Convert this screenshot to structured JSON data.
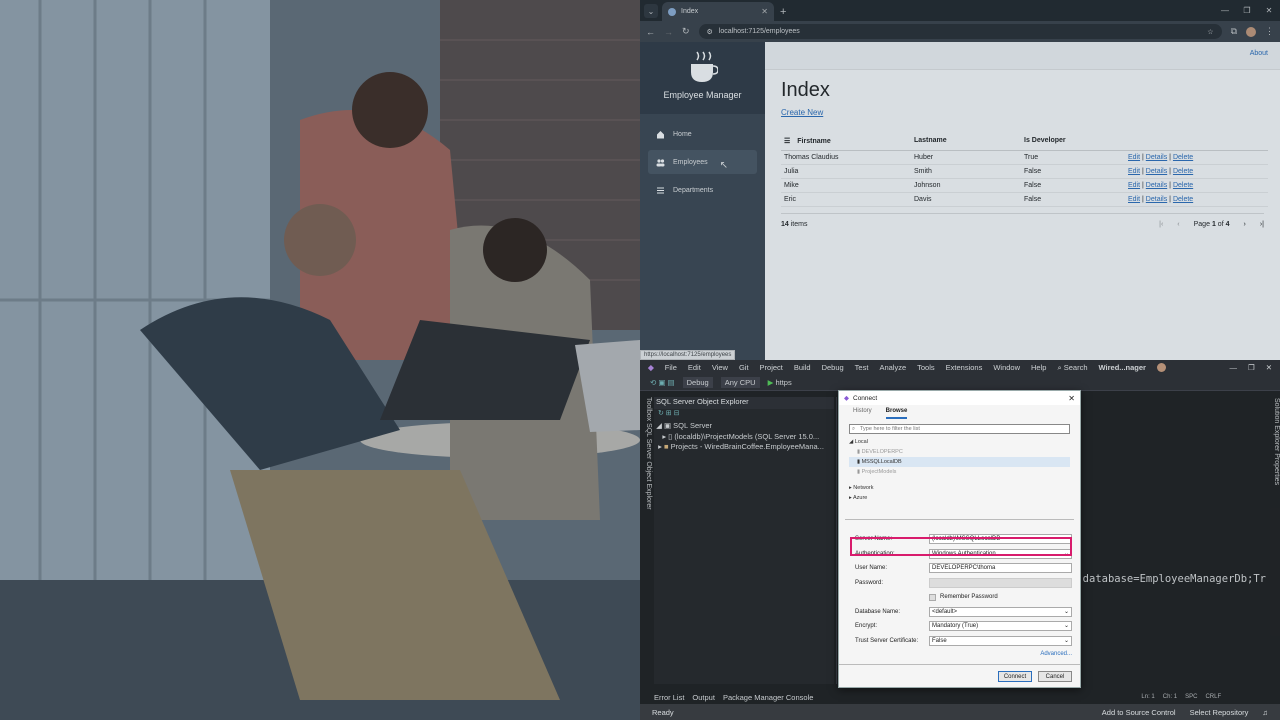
{
  "browser": {
    "tab_title": "Index",
    "url": "localhost:7125/employees",
    "status_url": "https://localhost:7125/employees"
  },
  "app": {
    "brand": "Employee Manager",
    "nav": [
      {
        "label": "Home",
        "icon": "home-icon"
      },
      {
        "label": "Employees",
        "icon": "people-icon"
      },
      {
        "label": "Departments",
        "icon": "list-icon"
      }
    ],
    "about": "About",
    "page_title": "Index",
    "create_new": "Create New",
    "columns": [
      "Firstname",
      "Lastname",
      "Is Developer"
    ],
    "rows": [
      {
        "first": "Thomas Claudius",
        "last": "Huber",
        "dev": "True"
      },
      {
        "first": "Julia",
        "last": "Smith",
        "dev": "False"
      },
      {
        "first": "Mike",
        "last": "Johnson",
        "dev": "False"
      },
      {
        "first": "Eric",
        "last": "Davis",
        "dev": "False"
      }
    ],
    "row_actions": {
      "edit": "Edit",
      "details": "Details",
      "delete": "Delete",
      "sep": "|"
    },
    "items_count": "14",
    "items_label": "items",
    "page_label": "Page",
    "page_current": "1",
    "page_of": "of",
    "page_total": "4"
  },
  "vs": {
    "menu": [
      "File",
      "Edit",
      "View",
      "Git",
      "Project",
      "Build",
      "Debug",
      "Test",
      "Analyze",
      "Tools",
      "Extensions",
      "Window",
      "Help"
    ],
    "search": "Search",
    "solution": "Wired...nager",
    "config": "Debug",
    "platform": "Any CPU",
    "run": "https",
    "explorer_title": "SQL Server Object Explorer",
    "tree": [
      "SQL Server",
      "(localdb)\\ProjectModels (SQL Server 15.0...",
      "Projects - WiredBrainCoffee.EmployeeMana..."
    ],
    "left_tabs": "Toolbox   SQL Server Object Explorer",
    "right_tabs": "Solution Explorer   Properties",
    "code": "database=EmployeeManagerDb;Tr",
    "bottom_tabs": [
      "Error List",
      "Output",
      "Package Manager Console"
    ],
    "status_ready": "Ready",
    "status_right": [
      "Add to Source Control",
      "Select Repository"
    ],
    "cursor_info": [
      "Ln: 1",
      "Ch: 1",
      "SPC",
      "CRLF"
    ]
  },
  "dialog": {
    "title": "Connect",
    "tabs": [
      "History",
      "Browse"
    ],
    "filter_placeholder": "Type here to filter the list",
    "local": "Local",
    "local_items": [
      "DEVELOPERPC",
      "MSSQLLocalDB",
      "ProjectModels"
    ],
    "network": "Network",
    "azure": "Azure",
    "server_name_label": "Server Name:",
    "server_name": "(localdb)\\MSSQLLocalDB",
    "auth_label": "Authentication:",
    "auth": "Windows Authentication",
    "user_label": "User Name:",
    "user": "DEVELOPERPC\\thoma",
    "password_label": "Password:",
    "remember": "Remember Password",
    "db_label": "Database Name:",
    "db": "<default>",
    "encrypt_label": "Encrypt:",
    "encrypt": "Mandatory (True)",
    "trust_label": "Trust Server Certificate:",
    "trust": "False",
    "advanced": "Advanced...",
    "connect": "Connect",
    "cancel": "Cancel"
  }
}
